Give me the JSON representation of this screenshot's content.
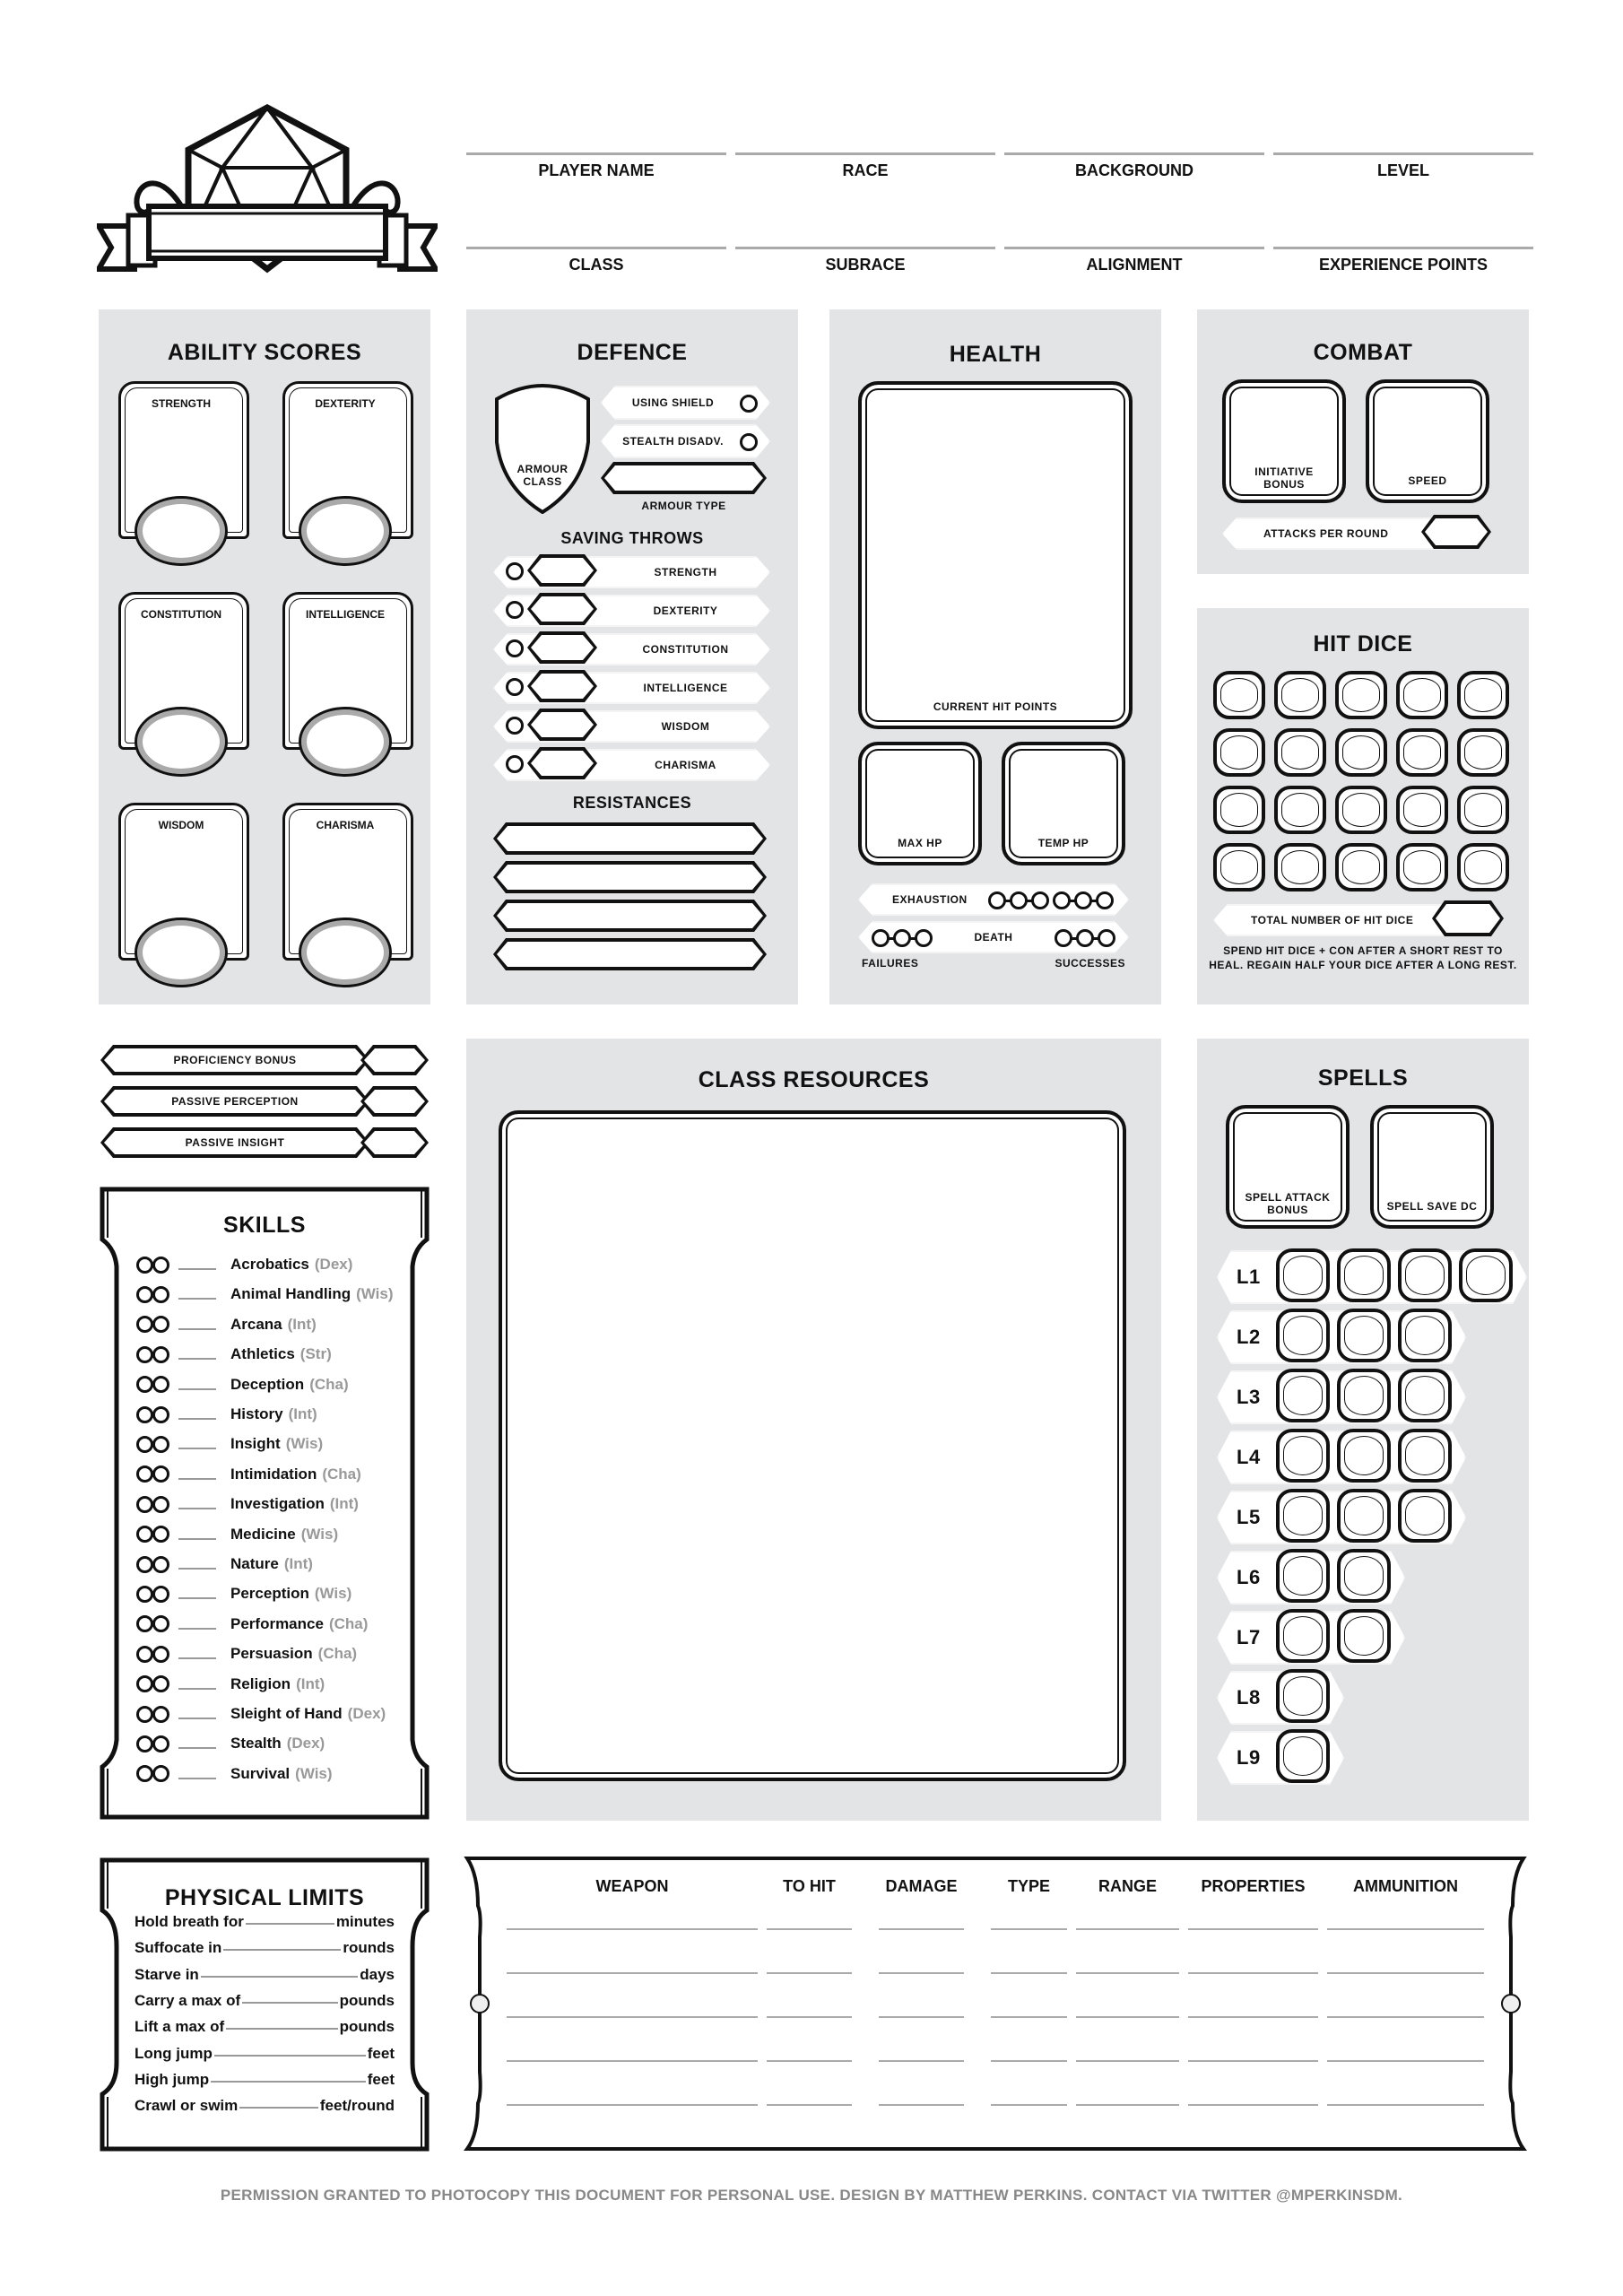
{
  "header": {
    "row1": [
      "PLAYER NAME",
      "RACE",
      "BACKGROUND",
      "LEVEL"
    ],
    "row2": [
      "CLASS",
      "SUBRACE",
      "ALIGNMENT",
      "EXPERIENCE POINTS"
    ],
    "logo": "d20-banner-logo"
  },
  "ability_scores": {
    "title": "ABILITY SCORES",
    "items": [
      "STRENGTH",
      "DEXTERITY",
      "CONSTITUTION",
      "INTELLIGENCE",
      "WISDOM",
      "CHARISMA"
    ]
  },
  "defence": {
    "title": "DEFENCE",
    "armour_class": "ARMOUR\nCLASS",
    "armour_class_l1": "ARMOUR",
    "armour_class_l2": "CLASS",
    "using_shield": "USING SHIELD",
    "stealth_disadv": "STEALTH DISADV.",
    "armour_type": "ARMOUR TYPE",
    "saving_throws_title": "SAVING THROWS",
    "saving_throws": [
      "STRENGTH",
      "DEXTERITY",
      "CONSTITUTION",
      "INTELLIGENCE",
      "WISDOM",
      "CHARISMA"
    ],
    "resistances_title": "RESISTANCES",
    "resistance_count": 4
  },
  "health": {
    "title": "HEALTH",
    "current_hp": "CURRENT HIT POINTS",
    "max_hp": "MAX HP",
    "temp_hp": "TEMP HP",
    "exhaustion": "EXHAUSTION",
    "exhaustion_levels": 6,
    "death": "DEATH",
    "failures": "FAILURES",
    "successes": "SUCCESSES",
    "death_save_count": 3
  },
  "combat": {
    "title": "COMBAT",
    "initiative_l1": "INITIATIVE",
    "initiative_l2": "BONUS",
    "speed": "SPEED",
    "attacks_per_round": "ATTACKS PER ROUND"
  },
  "hit_dice": {
    "title": "HIT DICE",
    "count": 20,
    "total_label": "TOTAL NUMBER OF HIT DICE",
    "note_l1": "SPEND HIT DICE + CON AFTER A SHORT REST TO",
    "note_l2": "HEAL. REGAIN HALF YOUR DICE AFTER A LONG REST."
  },
  "bonuses": [
    "PROFICIENCY BONUS",
    "PASSIVE PERCEPTION",
    "PASSIVE INSIGHT"
  ],
  "skills": {
    "title": "SKILLS",
    "items": [
      {
        "name": "Acrobatics",
        "attr": "(Dex)"
      },
      {
        "name": "Animal Handling",
        "attr": "(Wis)"
      },
      {
        "name": "Arcana",
        "attr": "(Int)"
      },
      {
        "name": "Athletics",
        "attr": "(Str)"
      },
      {
        "name": "Deception",
        "attr": "(Cha)"
      },
      {
        "name": "History",
        "attr": "(Int)"
      },
      {
        "name": "Insight",
        "attr": "(Wis)"
      },
      {
        "name": "Intimidation",
        "attr": "(Cha)"
      },
      {
        "name": "Investigation",
        "attr": "(Int)"
      },
      {
        "name": "Medicine",
        "attr": "(Wis)"
      },
      {
        "name": "Nature",
        "attr": "(Int)"
      },
      {
        "name": "Perception",
        "attr": "(Wis)"
      },
      {
        "name": "Performance",
        "attr": "(Cha)"
      },
      {
        "name": "Persuasion",
        "attr": "(Cha)"
      },
      {
        "name": "Religion",
        "attr": "(Int)"
      },
      {
        "name": "Sleight of Hand",
        "attr": "(Dex)"
      },
      {
        "name": "Stealth",
        "attr": "(Dex)"
      },
      {
        "name": "Survival",
        "attr": "(Wis)"
      }
    ]
  },
  "class_resources": {
    "title": "CLASS RESOURCES"
  },
  "spells": {
    "title": "SPELLS",
    "attack_bonus_l1": "SPELL ATTACK",
    "attack_bonus_l2": "BONUS",
    "save_dc": "SPELL SAVE DC",
    "slots": [
      {
        "level": "L1",
        "count": 4
      },
      {
        "level": "L2",
        "count": 3
      },
      {
        "level": "L3",
        "count": 3
      },
      {
        "level": "L4",
        "count": 3
      },
      {
        "level": "L5",
        "count": 3
      },
      {
        "level": "L6",
        "count": 2
      },
      {
        "level": "L7",
        "count": 2
      },
      {
        "level": "L8",
        "count": 1
      },
      {
        "level": "L9",
        "count": 1
      }
    ]
  },
  "physical_limits": {
    "title": "PHYSICAL LIMITS",
    "items": [
      {
        "label": "Hold breath for",
        "unit": "minutes"
      },
      {
        "label": "Suffocate in",
        "unit": "rounds"
      },
      {
        "label": "Starve in",
        "unit": "days"
      },
      {
        "label": "Carry a max of",
        "unit": "pounds"
      },
      {
        "label": "Lift a max of",
        "unit": "pounds"
      },
      {
        "label": "Long jump",
        "unit": "feet"
      },
      {
        "label": "High jump",
        "unit": "feet"
      },
      {
        "label": "Crawl or swim",
        "unit": "feet/round"
      }
    ]
  },
  "weapons": {
    "columns": [
      "WEAPON",
      "TO HIT",
      "DAMAGE",
      "TYPE",
      "RANGE",
      "PROPERTIES",
      "AMMUNITION"
    ],
    "row_count": 5
  },
  "footer": "PERMISSION GRANTED TO PHOTOCOPY THIS DOCUMENT FOR PERSONAL USE. DESIGN BY MATTHEW PERKINS. CONTACT VIA TWITTER @MPERKINSDM."
}
